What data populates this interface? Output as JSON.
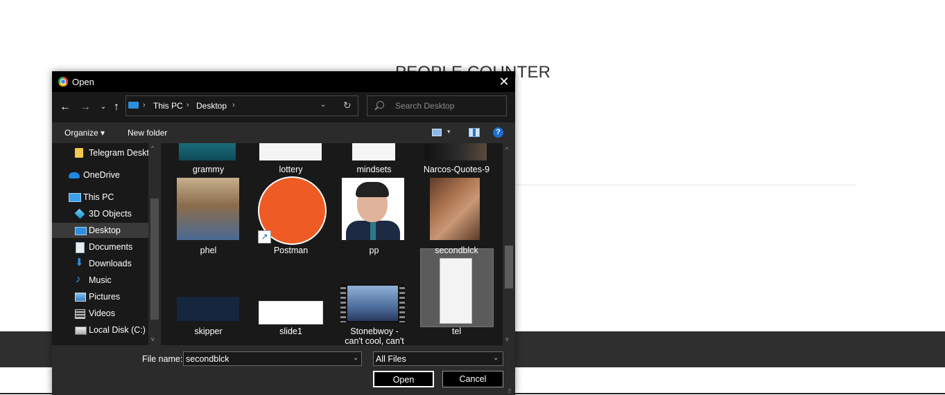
{
  "page": {
    "title": "PEOPLE COUNTER"
  },
  "dialog": {
    "title": "Open",
    "close_glyph": "✕",
    "nav": {
      "back_glyph": "←",
      "forward_glyph": "→",
      "recent_glyph": "⌄",
      "up_glyph": "↑"
    },
    "address": {
      "separator": "›",
      "crumbs": [
        "This PC",
        "Desktop"
      ],
      "dropdown_glyph": "⌄",
      "refresh_glyph": "↻"
    },
    "search": {
      "placeholder": "Search Desktop"
    },
    "toolbar": {
      "organize_label": "Organize ▾",
      "new_folder_label": "New folder",
      "view_dropdown_glyph": "▾",
      "help_glyph": "?"
    },
    "nav_pane": {
      "items": [
        {
          "label": "Telegram Deskto",
          "icon": "folder-icon"
        },
        {
          "label": "OneDrive",
          "icon": "onedrive-icon"
        },
        {
          "label": "This PC",
          "icon": "pc-icon"
        },
        {
          "label": "3D Objects",
          "icon": "3d-objects-icon"
        },
        {
          "label": "Desktop",
          "icon": "desktop-icon",
          "selected": true
        },
        {
          "label": "Documents",
          "icon": "documents-icon"
        },
        {
          "label": "Downloads",
          "icon": "downloads-icon"
        },
        {
          "label": "Music",
          "icon": "music-icon"
        },
        {
          "label": "Pictures",
          "icon": "pictures-icon"
        },
        {
          "label": "Videos",
          "icon": "videos-icon"
        },
        {
          "label": "Local Disk (C:)",
          "icon": "disk-icon"
        }
      ],
      "scroll_up_glyph": "^",
      "scroll_down_glyph": "v"
    },
    "files": {
      "items": [
        {
          "name": "grammy"
        },
        {
          "name": "lottery"
        },
        {
          "name": "mindsets"
        },
        {
          "name": "Narcos-Quotes-9"
        },
        {
          "name": "phel"
        },
        {
          "name": "Postman"
        },
        {
          "name": "pp"
        },
        {
          "name": "secondblck",
          "selected": true
        },
        {
          "name": "skipper"
        },
        {
          "name": "slide1"
        },
        {
          "name": "Stonebwoy -\ncan't cool, can't"
        },
        {
          "name": "tel"
        }
      ],
      "shortcut_glyph": "↗",
      "scroll_up_glyph": "^",
      "scroll_down_glyph": "v"
    },
    "bottom": {
      "file_name_label": "File name:",
      "file_name_value": "secondblck",
      "file_type_value": "All Files",
      "dropdown_glyph": "⌄",
      "open_label": "Open",
      "cancel_label": "Cancel",
      "grip_glyph": "⠿"
    },
    "colors": {
      "dialog_bg": "#2b2b2b",
      "pane_bg": "#191919",
      "accent": "#1f6fd0",
      "postman_orange": "#ef5b25"
    }
  }
}
